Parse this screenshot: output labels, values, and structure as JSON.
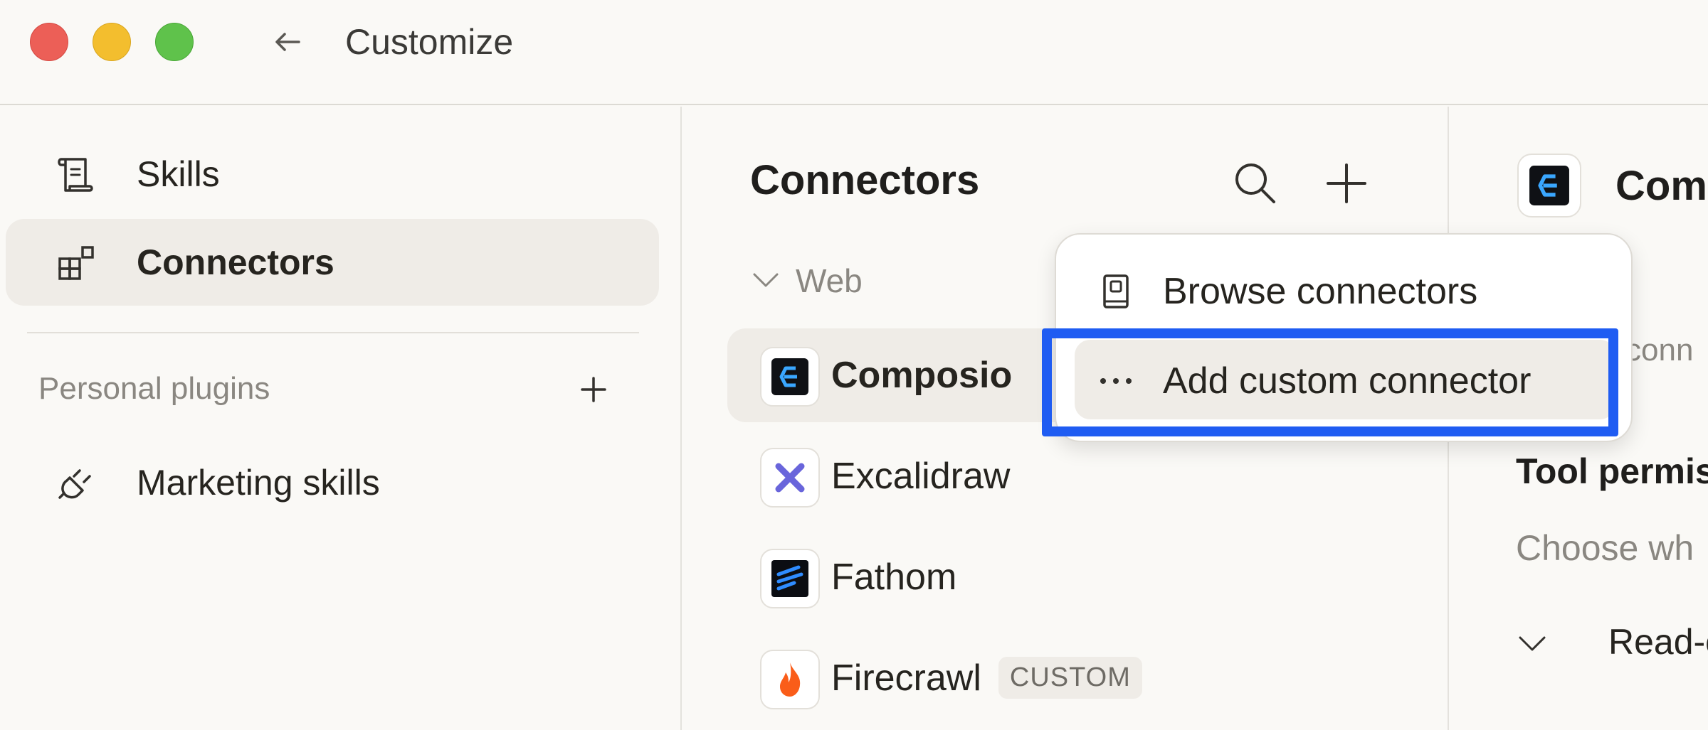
{
  "window": {
    "title": "Customize"
  },
  "sidebar": {
    "items": [
      {
        "label": "Skills",
        "icon": "scroll-icon",
        "active": false
      },
      {
        "label": "Connectors",
        "icon": "grid-plus-icon",
        "active": true
      }
    ],
    "personal_plugins": {
      "label": "Personal plugins",
      "items": [
        {
          "label": "Marketing skills",
          "icon": "plug-icon"
        }
      ]
    }
  },
  "connectors_panel": {
    "title": "Connectors",
    "group": {
      "label": "Web",
      "expanded": true
    },
    "items": [
      {
        "name": "Composio",
        "icon": "composio-logo-icon",
        "selected": true,
        "badge": ""
      },
      {
        "name": "Excalidraw",
        "icon": "excalidraw-logo-icon",
        "selected": false,
        "badge": ""
      },
      {
        "name": "Fathom",
        "icon": "fathom-logo-icon",
        "selected": false,
        "badge": ""
      },
      {
        "name": "Firecrawl",
        "icon": "firecrawl-logo-icon",
        "selected": false,
        "badge": "CUSTOM"
      }
    ]
  },
  "add_menu": {
    "items": [
      {
        "label": "Browse connectors",
        "icon": "book-icon"
      },
      {
        "label": "Add custom connector",
        "icon": "ellipsis-icon",
        "highlighted": true
      }
    ],
    "highlight_color": "#1f5cf2"
  },
  "detail_panel": {
    "title": "Com",
    "snippet": "conn",
    "tool_permissions_heading": "Tool permis",
    "tool_permissions_desc": "Choose wh",
    "section_label": "Read-o"
  },
  "colors": {
    "background": "#faf9f6",
    "active_row": "#efece7",
    "muted_text": "#8a8781",
    "composio_brand": "#3aa7ff",
    "excalidraw_brand": "#6965db",
    "firecrawl_brand": "#fa5d19"
  }
}
